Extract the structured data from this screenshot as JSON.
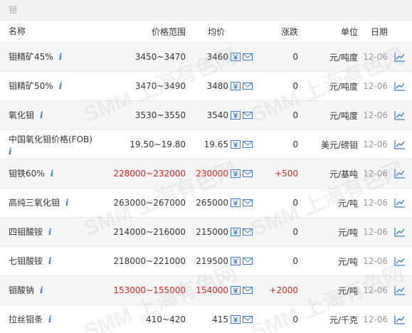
{
  "section": {
    "title": "钼"
  },
  "columns": {
    "name": "名称",
    "range": "价格范围",
    "avg": "均价",
    "change": "涨跌",
    "unit": "单位",
    "date": "日期"
  },
  "info_label": "i",
  "watermark_text": "SMM 上海有色网",
  "colors": {
    "up": "#e21b1b",
    "info": "#3a7bd5",
    "icon": "#3a7bd5"
  },
  "rows": [
    {
      "name": "钼精矿45%",
      "range": "3450~3470",
      "avg": "3460",
      "change": "0",
      "unit": "元/吨度",
      "date": "12-06",
      "up": false
    },
    {
      "name": "钼精矿50%",
      "range": "3470~3490",
      "avg": "3480",
      "change": "0",
      "unit": "元/吨度",
      "date": "12-06",
      "up": false
    },
    {
      "name": "氧化钼",
      "range": "3530~3550",
      "avg": "3540",
      "change": "0",
      "unit": "元/吨度",
      "date": "12-06",
      "up": false
    },
    {
      "name": "中国氧化钼价格(FOB)",
      "range": "19.50~19.80",
      "avg": "19.65",
      "change": "0",
      "unit": "美元/磅钼",
      "date": "12-06",
      "up": false
    },
    {
      "name": "钼铁60%",
      "range": "228000~232000",
      "avg": "230000",
      "change": "+500",
      "unit": "元/基吨",
      "date": "12-06",
      "up": true
    },
    {
      "name": "高纯三氧化钼",
      "range": "263000~267000",
      "avg": "265000",
      "change": "0",
      "unit": "元/吨",
      "date": "12-06",
      "up": false
    },
    {
      "name": "四钼酸铵",
      "range": "214000~216000",
      "avg": "215000",
      "change": "0",
      "unit": "元/吨",
      "date": "12-06",
      "up": false
    },
    {
      "name": "七钼酸铵",
      "range": "218000~221000",
      "avg": "219500",
      "change": "0",
      "unit": "元/吨",
      "date": "12-06",
      "up": false
    },
    {
      "name": "钼酸钠",
      "range": "153000~155000",
      "avg": "154000",
      "change": "+2000",
      "unit": "元/吨",
      "date": "12-06",
      "up": true
    },
    {
      "name": "拉丝钼条",
      "range": "410~420",
      "avg": "415",
      "change": "0",
      "unit": "元/千克",
      "date": "12-06",
      "up": false
    }
  ]
}
